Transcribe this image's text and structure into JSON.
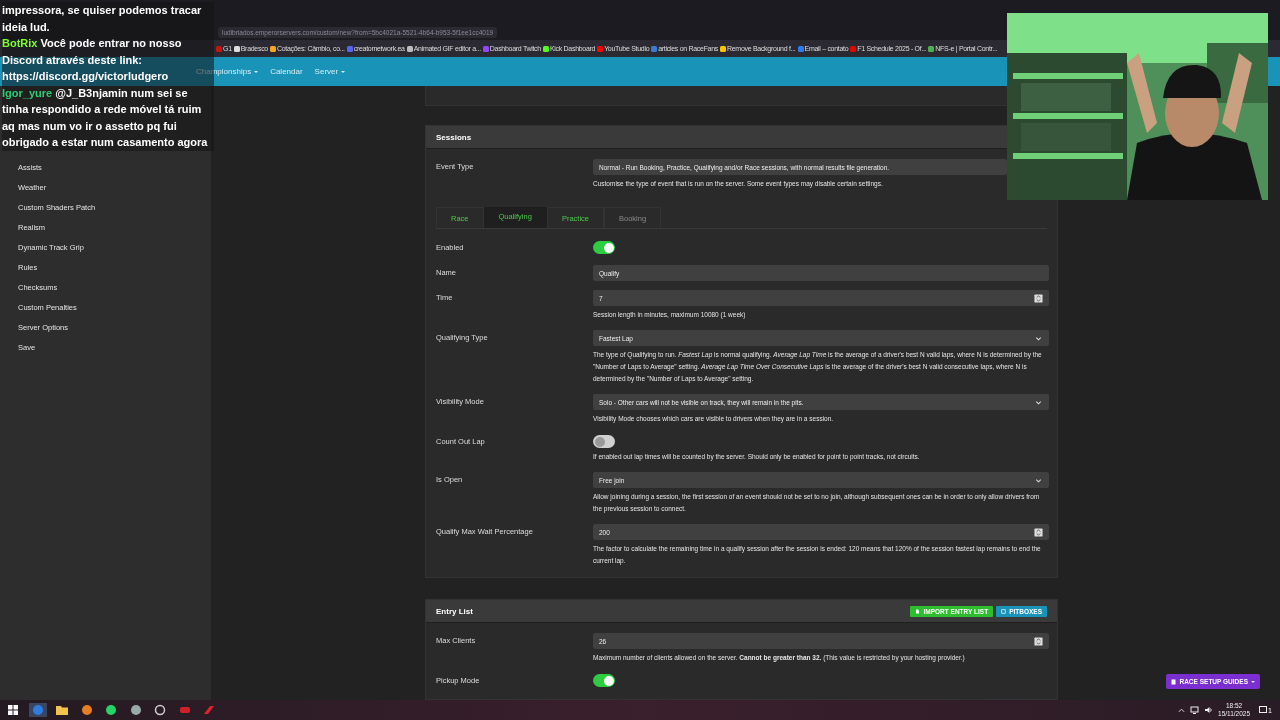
{
  "chat": [
    {
      "text": "impressora, se quiser podemos tracar ideia lud."
    },
    {
      "user": "BotRix",
      "color": "#7dff2a",
      "text": "Você pode entrar no nosso Discord através deste link: https://discord.gg/victorludgero"
    },
    {
      "user": "Igor_yure",
      "color": "#2ecc71",
      "text": "@J_B3njamin num sei se tinha respondido a rede móvel tá ruim aq mas num vo ir o assetto pq fui obrigado a estar num casamento agora"
    }
  ],
  "browser": {
    "url": "ludibriados.emperorservers.com/custom/new?from=5bc4021a-5521-4b64-b953-5f1ee1cc4019",
    "bookmarks": [
      {
        "label": "G1",
        "color": "#c4170c"
      },
      {
        "label": "Bradesco",
        "color": "#dddddd"
      },
      {
        "label": "Cotações: Câmbio, co...",
        "color": "#f5a623"
      },
      {
        "label": "creatornetwork.ea",
        "color": "#5865f2"
      },
      {
        "label": "Animated GIF editor a...",
        "color": "#bbbbbb"
      },
      {
        "label": "Dashboard Twitch",
        "color": "#9146ff"
      },
      {
        "label": "Kick Dashboard",
        "color": "#53fc18"
      },
      {
        "label": "YouTube Studio",
        "color": "#ff0000"
      },
      {
        "label": "articles on RaceFans",
        "color": "#3a7bd5"
      },
      {
        "label": "Remove Background f...",
        "color": "#f7c600"
      },
      {
        "label": "Email – contato",
        "color": "#2b7de9"
      },
      {
        "label": "F1 Schedule 2025 - Of...",
        "color": "#e10600"
      },
      {
        "label": "NFS-e | Portal Contr...",
        "color": "#4caf50"
      }
    ]
  },
  "navbar": {
    "items": [
      {
        "label": "Championships",
        "dropdown": true
      },
      {
        "label": "Calendar",
        "dropdown": false
      },
      {
        "label": "Server",
        "dropdown": true
      }
    ]
  },
  "sidebar": {
    "items": [
      "Assists",
      "Weather",
      "Custom Shaders Patch",
      "Realism",
      "Dynamic Track Grip",
      "Rules",
      "Checksums",
      "Custom Penalties",
      "Server Options",
      "Save"
    ]
  },
  "sessions": {
    "title": "Sessions",
    "rows": [
      {
        "kind": "text",
        "label": "Event Type",
        "value": "Normal - Run Booking, Practice, Qualifying and/or Race sessions, with normal results file generation.",
        "help": "Customise the type of event that is run on the server. Some event types may disable certain settings."
      },
      {
        "kind": "tabs",
        "tabs": [
          {
            "label": "Race",
            "selected": false,
            "disabled": false
          },
          {
            "label": "Qualifying",
            "selected": true,
            "disabled": false
          },
          {
            "label": "Practice",
            "selected": false,
            "disabled": false
          },
          {
            "label": "Booking",
            "selected": false,
            "disabled": true
          }
        ]
      },
      {
        "kind": "toggle",
        "label": "Enabled",
        "on": true
      },
      {
        "kind": "text",
        "label": "Name",
        "value": "Qualify"
      },
      {
        "kind": "number",
        "label": "Time",
        "value": "7",
        "help": "Session length in minutes, maximum 10080 (1 week)"
      },
      {
        "kind": "select",
        "label": "Qualifying Type",
        "value": "Fastest Lap",
        "help": "The type of Qualifying to run. *Fastest Lap* is normal qualifying. *Average Lap Time* is the average of a driver's best N valid laps, where N is determined by the \"Number of Laps to Average\" setting. *Average Lap Time Over Consecutive Laps* is the average of the driver's best N valid consecutive laps, where N is determined by the \"Number of Laps to Average\" setting."
      },
      {
        "kind": "select",
        "label": "Visibility Mode",
        "value": "Solo - Other cars will not be visible on track, they will remain in the pits.",
        "help": "Visibility Mode chooses which cars are visible to drivers when they are in a session."
      },
      {
        "kind": "toggle",
        "label": "Count Out Lap",
        "on": false,
        "help": "If enabled out lap times will be counted by the server. Should only be enabled for point to point tracks, not circuits."
      },
      {
        "kind": "select",
        "label": "Is Open",
        "value": "Free join",
        "help": "Allow joining during a session, the first session of an event should not be set to no join, although subsequent ones can be in order to only allow drivers from the previous session to connect."
      },
      {
        "kind": "number",
        "label": "Qualify Max Wait Percentage",
        "value": "200",
        "help": "The factor to calculate the remaining time in a qualify session after the session is ended: 120 means that 120% of the session fastest lap remains to end the current lap."
      }
    ]
  },
  "entry_list": {
    "title": "Entry List",
    "buttons": [
      {
        "kind": "import",
        "label": "IMPORT ENTRY LIST"
      },
      {
        "kind": "pitboxes",
        "label": "PITBOXES"
      }
    ],
    "rows": [
      {
        "kind": "number",
        "label": "Max Clients",
        "value": "26",
        "help": "Maximum number of clients allowed on the server. **Cannot be greater than 32.** (This value is restricted by your hosting provider.)"
      },
      {
        "kind": "toggle",
        "label": "Pickup Mode",
        "on": true
      }
    ]
  },
  "guides_button": {
    "label": "RACE SETUP GUIDES"
  },
  "taskbar": {
    "time": "18:52",
    "date": "15/11/2025",
    "notifications": "1"
  }
}
